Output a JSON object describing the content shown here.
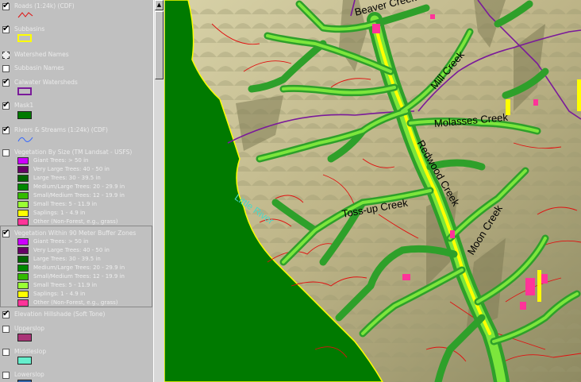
{
  "legend": {
    "roads": {
      "title": "Roads (1:24k) (CDF)",
      "checked": true
    },
    "subbasins": {
      "title": "Subbasins",
      "checked": true
    },
    "watershed_names": {
      "title": "Watershed Names",
      "checked": false
    },
    "subbasin_names": {
      "title": "Subbasin Names",
      "checked": false
    },
    "calwater": {
      "title": "Calwater Watersheds",
      "checked": true
    },
    "mask": {
      "title": "Mask1",
      "checked": true
    },
    "rivers": {
      "title": "Rivers & Streams (1:24k) (CDF)",
      "checked": true
    },
    "veg_size": {
      "title": "Vegetation By Size (TM Landsat - USFS)",
      "checked": false,
      "classes": [
        {
          "label": "Giant Trees: > 50 in",
          "color": "#cc00ff"
        },
        {
          "label": "Very Large Trees: 40 - 50 in",
          "color": "#660066"
        },
        {
          "label": "Large Trees: 30 - 39.5 in",
          "color": "#006600"
        },
        {
          "label": "Medium/Large Trees: 20 - 29.9 in",
          "color": "#008800"
        },
        {
          "label": "Small/Medium Trees: 12 - 19.9 in",
          "color": "#33bb00"
        },
        {
          "label": "Small Trees: 5 - 11.9 in",
          "color": "#99ff33"
        },
        {
          "label": "Saplings: 1 - 4.9 in",
          "color": "#ffff00"
        },
        {
          "label": "Other (Non-Forest, e.g., grass)",
          "color": "#ff3399"
        }
      ]
    },
    "veg_buffer": {
      "title": "Vegetation Within 90 Meter Buffer Zones",
      "checked": true,
      "classes": [
        {
          "label": "Giant Trees: > 50 in",
          "color": "#cc00ff"
        },
        {
          "label": "Very Large Trees: 40 - 50 in",
          "color": "#660066"
        },
        {
          "label": "Large Trees: 30 - 39.5 in",
          "color": "#006600"
        },
        {
          "label": "Medium/Large Trees: 20 - 29.9 in",
          "color": "#008800"
        },
        {
          "label": "Small/Medium Trees: 12 - 19.9 in",
          "color": "#33bb00"
        },
        {
          "label": "Small Trees: 5 - 11.9 in",
          "color": "#99ff33"
        },
        {
          "label": "Saplings: 1 - 4.9 in",
          "color": "#ffff00"
        },
        {
          "label": "Other (Non-Forest, e.g., grass)",
          "color": "#ff3399"
        }
      ]
    },
    "hillshade": {
      "title": "Elevation Hillshade (Soft Tone)",
      "checked": true
    },
    "upper_slope": {
      "title": "Upperslop",
      "checked": false,
      "color": "#aa3377"
    },
    "middle_slope": {
      "title": "Middleslop",
      "checked": false,
      "color": "#66eecc"
    },
    "lower_slope": {
      "title": "Lowerslop",
      "checked": false,
      "color": "#3366aa"
    }
  },
  "map": {
    "creek_labels": [
      "Beaver Creek",
      "Mill Creek",
      "Molasses Creek",
      "Redwood Creek",
      "Toss-up Creek",
      "Moon Creek"
    ],
    "river_label": "Little River",
    "colors": {
      "ocean": "#007a00",
      "terrain": "#c8c096",
      "road": "#e01010",
      "watershed": "#7a1a9a",
      "buffer_light": "#7ce63c",
      "buffer_dark": "#2ea02a",
      "sapling": "#ffff00",
      "non_forest": "#ff3399"
    }
  }
}
